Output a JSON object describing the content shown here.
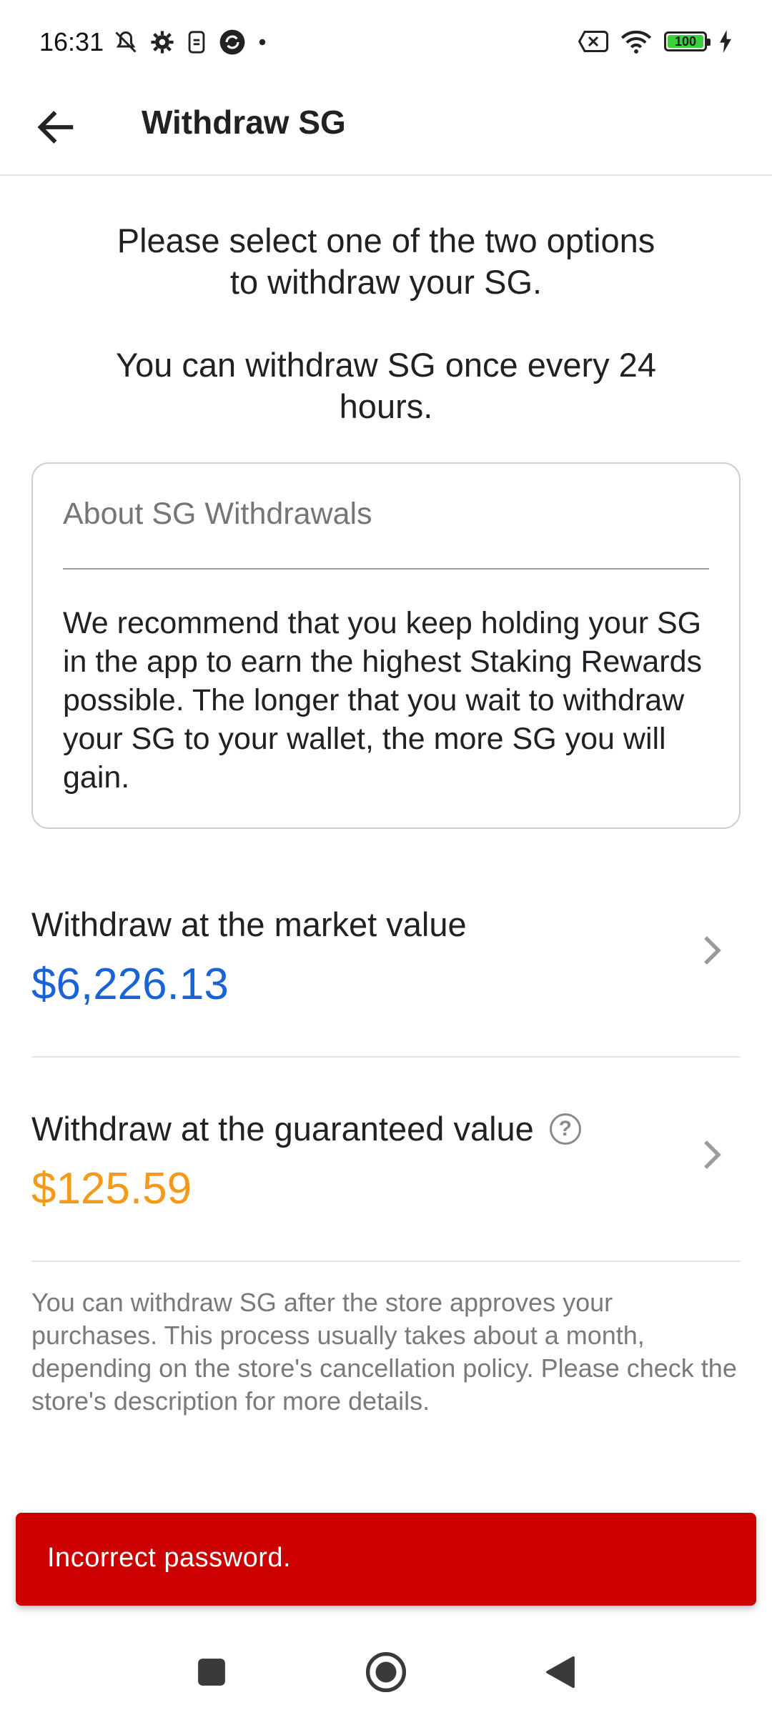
{
  "status_bar": {
    "time": "16:31",
    "battery_level": "100",
    "icons": [
      "mute-icon",
      "gear-icon",
      "sim-icon",
      "sync-icon",
      "dot-icon",
      "no-sim-icon",
      "wifi-icon",
      "battery-icon",
      "charging-icon"
    ]
  },
  "app_bar": {
    "title": "Withdraw SG",
    "back_icon": "arrow-left-icon"
  },
  "intro": {
    "line1": "Please select one of the two options",
    "line2": "to withdraw your SG.",
    "line3": "You can withdraw SG once every 24",
    "line4": "hours."
  },
  "about": {
    "title": "About SG Withdrawals",
    "body": "We recommend that you keep holding your SG in the app to earn the highest Staking Rewards possible. The longer that you wait to withdraw your SG to your wallet, the more SG you will gain."
  },
  "options": [
    {
      "label": "Withdraw at the market value",
      "value": "$6,226.13",
      "color": "#1a63d6"
    },
    {
      "label": "Withdraw at the guaranteed value",
      "value": "$125.59",
      "color": "#f39a1b",
      "help": "?"
    }
  ],
  "footnote": "You can withdraw SG after the store approves your purchases. This process usually takes about a month, depending on the store's cancellation policy. Please check the store's description for more details.",
  "snackbar": {
    "message": "Incorrect password.",
    "color": "#cc0000"
  },
  "nav_bar": {
    "buttons": [
      "recents-square-icon",
      "home-circle-icon",
      "back-triangle-icon"
    ]
  }
}
